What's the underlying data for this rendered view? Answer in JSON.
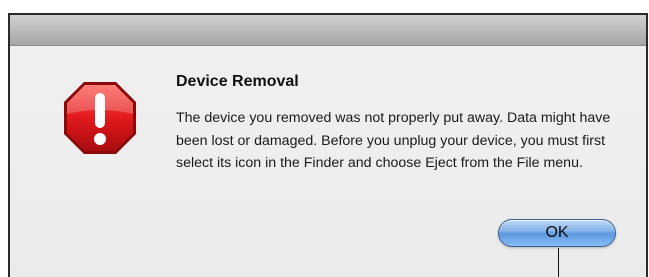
{
  "dialog": {
    "title": "Device Removal",
    "message": "The device you removed was not properly put away. Data might have been lost or damaged. Before you unplug your device, you must first select its icon in the Finder and choose Eject from the File menu.",
    "ok_label": "OK",
    "icon": "stop-alert-icon"
  },
  "colors": {
    "icon_red": "#d8161b",
    "button_blue": "#5d98df"
  }
}
